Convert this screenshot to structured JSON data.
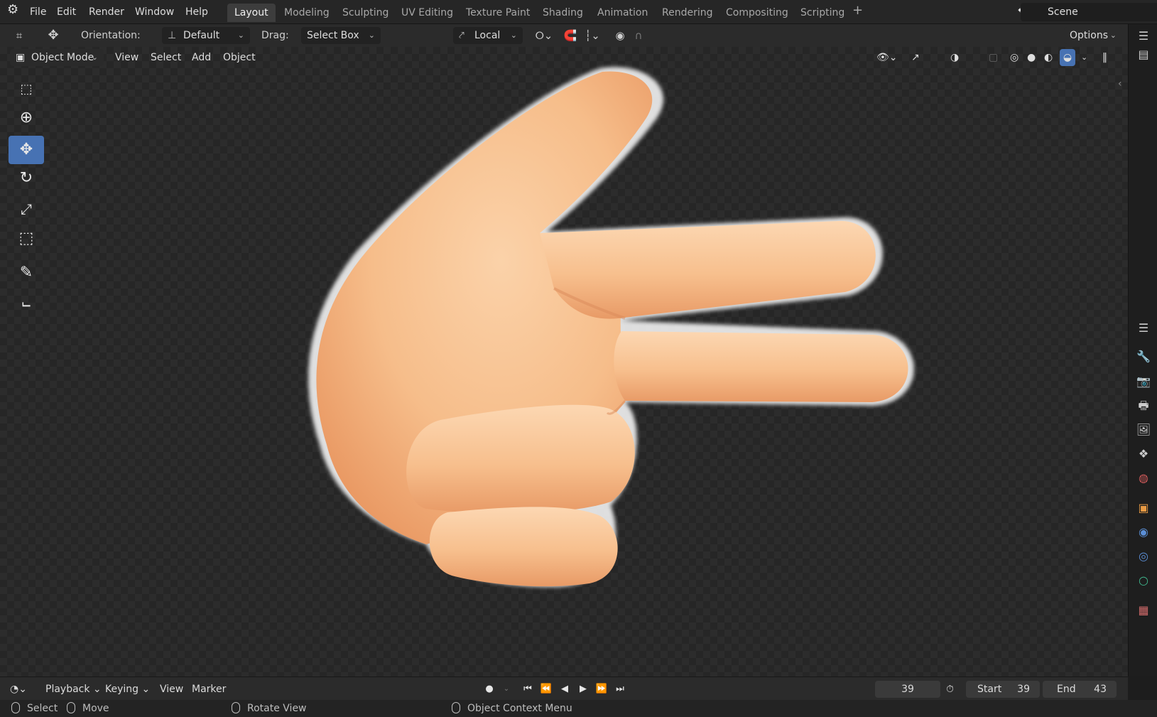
{
  "menubar": {
    "items": [
      "File",
      "Edit",
      "Render",
      "Window",
      "Help"
    ]
  },
  "workspaces": {
    "tabs": [
      "Layout",
      "Modeling",
      "Sculpting",
      "UV Editing",
      "Texture Paint",
      "Shading",
      "Animation",
      "Rendering",
      "Compositing",
      "Scripting"
    ],
    "active": "Layout"
  },
  "scene": {
    "name": "Scene"
  },
  "toolheader": {
    "orientation_label": "Orientation:",
    "orientation_value": "Default",
    "drag_label": "Drag:",
    "drag_value": "Select Box",
    "pivot_value": "Local",
    "options_label": "Options"
  },
  "viewheader": {
    "mode": "Object Mode",
    "menus": [
      "View",
      "Select",
      "Add",
      "Object"
    ]
  },
  "toolbar": {
    "tools": [
      "select-box",
      "cursor",
      "move",
      "rotate",
      "scale",
      "transform",
      "annotate",
      "measure"
    ],
    "active": "move"
  },
  "timeline": {
    "menus": [
      "Playback",
      "Keying",
      "View",
      "Marker"
    ],
    "current_frame": "39",
    "start_label": "Start",
    "start_value": "39",
    "end_label": "End",
    "end_value": "43"
  },
  "statusbar": {
    "items": [
      "Select",
      "Move",
      "Rotate View",
      "Object Context Menu"
    ]
  },
  "colors": {
    "accent": "#4772b3",
    "skin_light": "#f8c79a",
    "skin_dark": "#e89966"
  }
}
